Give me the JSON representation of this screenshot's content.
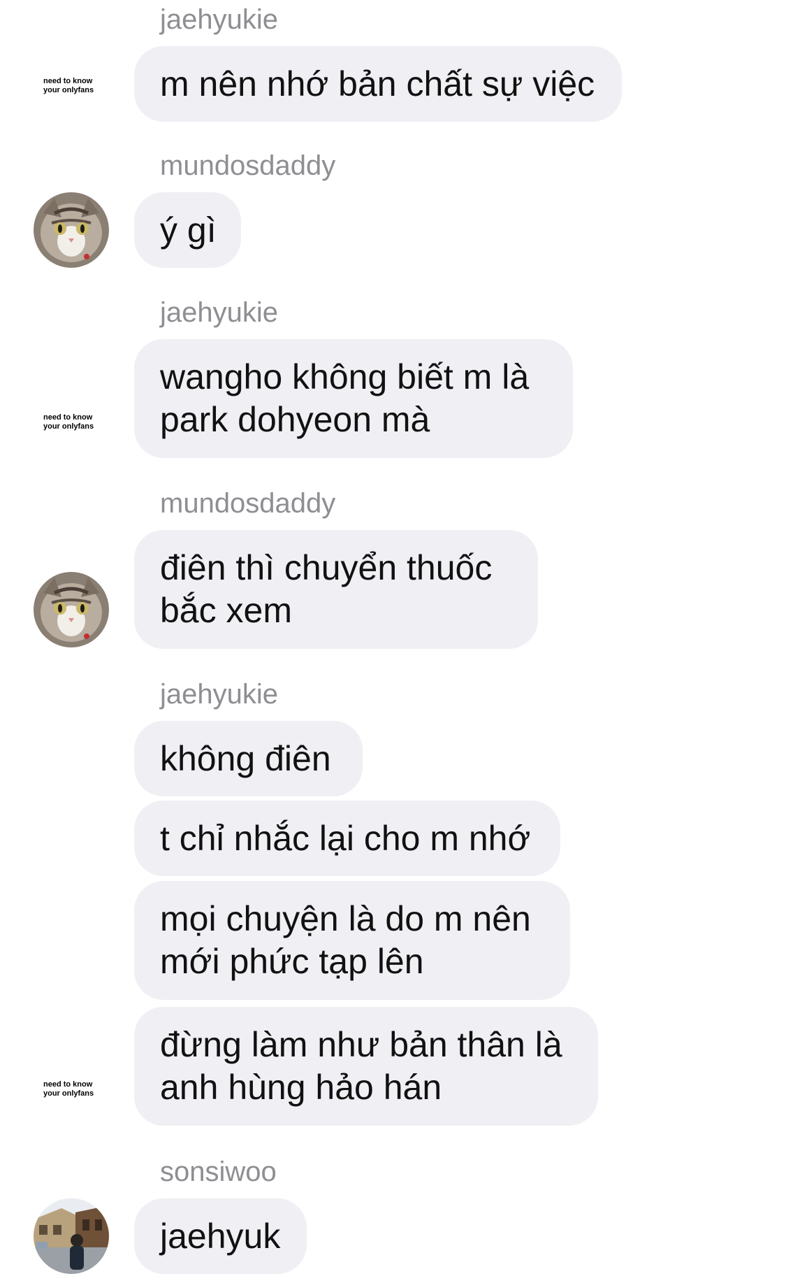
{
  "colors": {
    "bubble": "#efeff4",
    "sender": "#8e8e93",
    "text": "#111111"
  },
  "avatars": {
    "jaehyukie": {
      "kind": "text",
      "text": "need to know\nyour onlyfans"
    },
    "mundosdaddy": {
      "kind": "photo",
      "icon": "cat-photo-icon"
    },
    "sonsiwoo": {
      "kind": "photo",
      "icon": "street-photo-icon"
    }
  },
  "messages": [
    {
      "sender": "jaehyukie",
      "lines": "m nên nhớ bản chất sự việc"
    },
    {
      "sender": "mundosdaddy",
      "lines": "ý gì"
    },
    {
      "sender": "jaehyukie",
      "lines": "wangho không biết m là\npark dohyeon mà"
    },
    {
      "sender": "mundosdaddy",
      "lines": "điên thì chuyển thuốc\nbắc xem"
    },
    {
      "sender": "jaehyukie",
      "lines": "không điên"
    },
    {
      "sender": "jaehyukie",
      "lines": "t chỉ nhắc lại cho m nhớ"
    },
    {
      "sender": "jaehyukie",
      "lines": "mọi chuyện là do m nên\nmới phức tạp lên"
    },
    {
      "sender": "jaehyukie",
      "lines": "đừng làm như bản thân là\nanh hùng hảo hán"
    },
    {
      "sender": "sonsiwoo",
      "lines": "jaehyuk"
    }
  ],
  "sender_labels": [
    "jaehyukie",
    "mundosdaddy",
    "jaehyukie",
    "mundosdaddy",
    "jaehyukie",
    "sonsiwoo"
  ]
}
